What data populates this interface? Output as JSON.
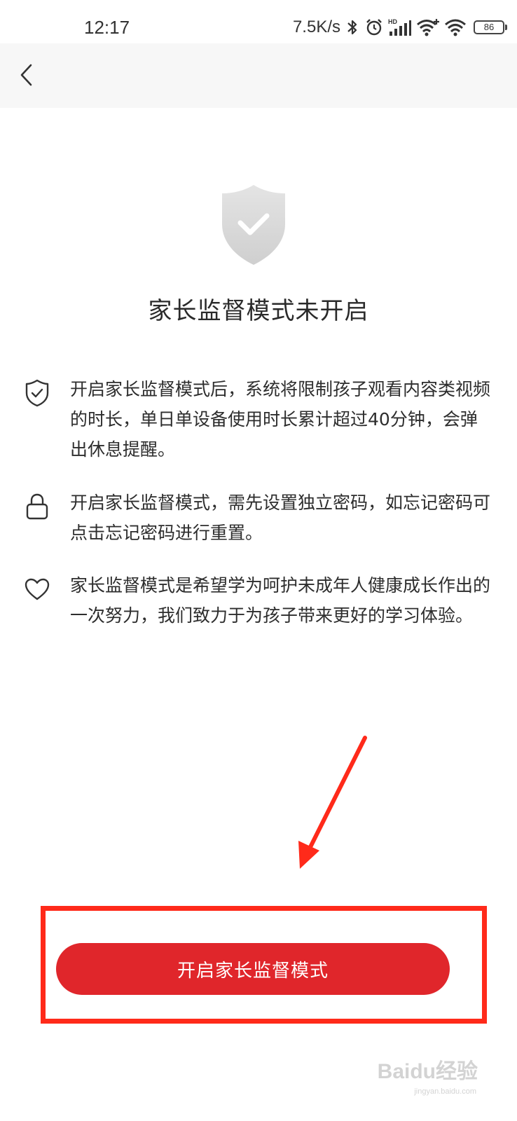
{
  "status_bar": {
    "time": "12:17",
    "net_speed": "7.5K/s",
    "icons": [
      "bluetooth-icon",
      "alarm-icon",
      "hd-signal-icon",
      "wifi-plus-icon",
      "wifi-icon",
      "battery-icon"
    ],
    "battery_level": "86"
  },
  "nav": {
    "back_icon": "chevron-left-icon"
  },
  "hero": {
    "icon": "shield-check-icon",
    "title": "家长监督模式未开启"
  },
  "info_items": [
    {
      "icon": "shield-check-outline-icon",
      "text": "开启家长监督模式后，系统将限制孩子观看内容类视频的时长，单日单设备使用时长累计超过40分钟，会弹出休息提醒。"
    },
    {
      "icon": "lock-icon",
      "text": "开启家长监督模式，需先设置独立密码，如忘记密码可点击忘记密码进行重置。"
    },
    {
      "icon": "heart-icon",
      "text": "家长监督模式是希望学为呵护未成年人健康成长作出的一次努力，我们致力于为孩子带来更好的学习体验。"
    }
  ],
  "primary_button": {
    "label": "开启家长监督模式"
  },
  "colors": {
    "primary": "#e0262b",
    "annotation": "#ff2a1a",
    "nav_background": "#f7f7f7"
  },
  "watermark": {
    "text": "Baidu经验",
    "sub": "jingyan.baidu.com"
  }
}
